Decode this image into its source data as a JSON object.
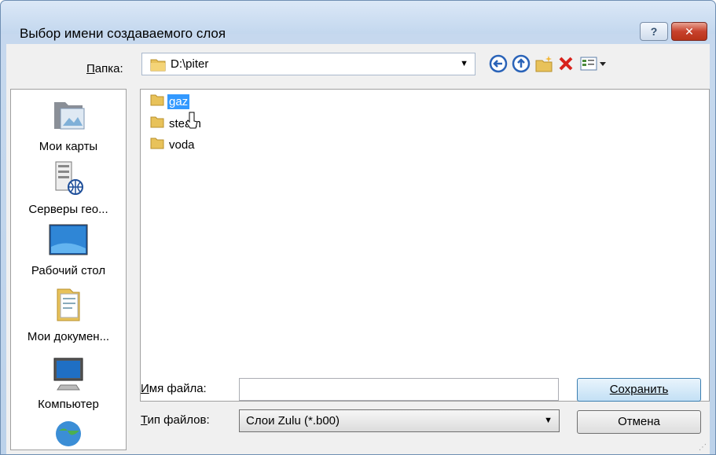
{
  "window": {
    "title": "Выбор имени создаваемого слоя",
    "help_label": "?",
    "close_label": "✕"
  },
  "folder": {
    "label": "Папка:",
    "path": "D:\\piter"
  },
  "places": [
    {
      "label": "Мои карты",
      "icon": "my-maps-icon"
    },
    {
      "label": "Серверы гео...",
      "icon": "geo-servers-icon"
    },
    {
      "label": "Рабочий стол",
      "icon": "desktop-icon"
    },
    {
      "label": "Мои докумен...",
      "icon": "my-documents-icon"
    },
    {
      "label": "Компьютер",
      "icon": "computer-icon"
    }
  ],
  "files": [
    {
      "name": "gaz",
      "selected": true
    },
    {
      "name": "steam",
      "selected": false
    },
    {
      "name": "voda",
      "selected": false
    }
  ],
  "filename": {
    "label": "Имя файла:",
    "value": ""
  },
  "filetype": {
    "label": "Тип файлов:",
    "selected": "Слои Zulu (*.b00)"
  },
  "buttons": {
    "save": "Сохранить",
    "cancel": "Отмена"
  }
}
